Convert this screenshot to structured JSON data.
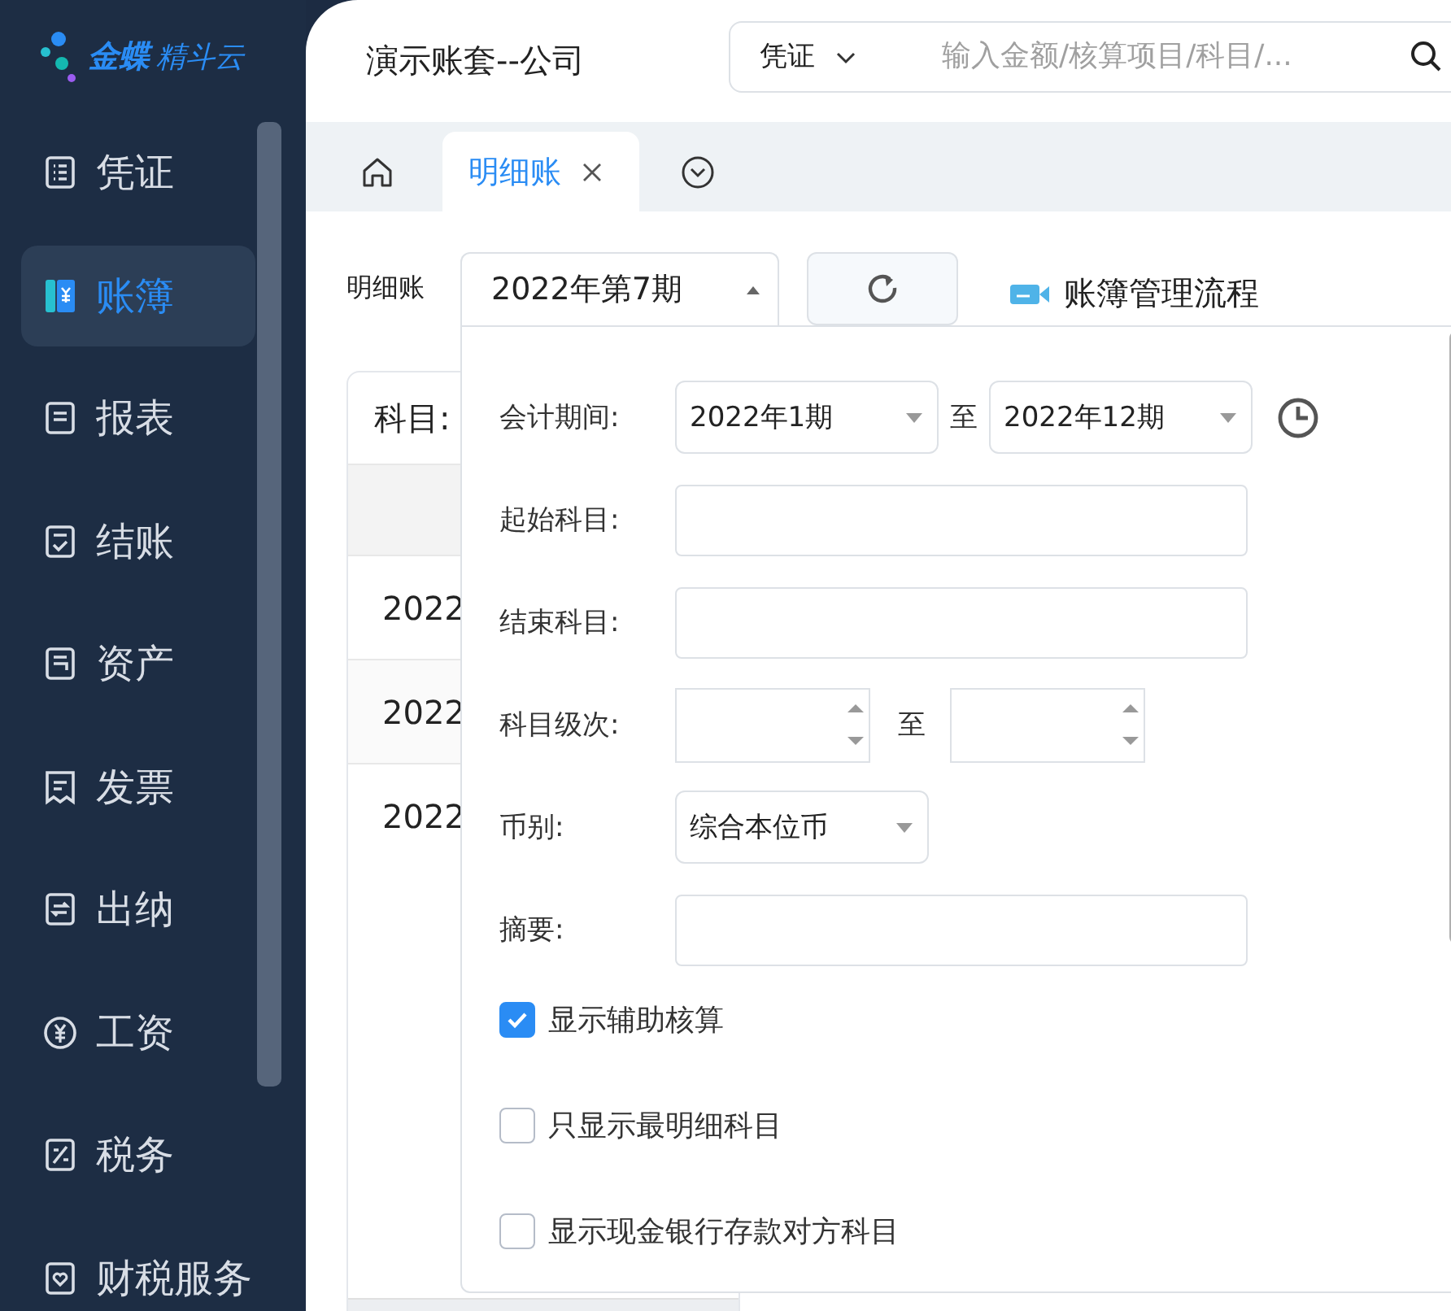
{
  "sidebar": {
    "logo": {
      "brand": "金蝶",
      "product": "精斗云"
    },
    "items": [
      {
        "label": "凭证",
        "selected": false
      },
      {
        "label": "账簿",
        "selected": true
      },
      {
        "label": "报表",
        "selected": false
      },
      {
        "label": "结账",
        "selected": false
      },
      {
        "label": "资产",
        "selected": false
      },
      {
        "label": "发票",
        "selected": false
      },
      {
        "label": "出纳",
        "selected": false
      },
      {
        "label": "工资",
        "selected": false
      },
      {
        "label": "税务",
        "selected": false
      },
      {
        "label": "财税服务",
        "selected": false
      }
    ]
  },
  "header": {
    "account_set": "演示账套--公司",
    "search": {
      "scope": "凭证",
      "placeholder": "输入金额/核算项目/科目/..."
    }
  },
  "tabs": [
    {
      "label": "明细账",
      "selected": true
    }
  ],
  "toolbar": {
    "label": "明细账",
    "period": "2022年第7期",
    "flow_link": "账簿管理流程"
  },
  "table": {
    "subject_label": "科目:",
    "rows": [
      {
        "column_1": "2022"
      },
      {
        "column_1": "2022"
      },
      {
        "column_1": "2022"
      }
    ]
  },
  "filter_panel": {
    "fields": [
      {
        "kind": "period_range",
        "label": "会计期间:",
        "from": "2022年1期",
        "to_label": "至",
        "to": "2022年12期"
      },
      {
        "kind": "text",
        "label": "起始科目:"
      },
      {
        "kind": "text",
        "label": "结束科目:"
      },
      {
        "kind": "number_range",
        "label": "科目级次:",
        "to_label": "至"
      },
      {
        "kind": "select",
        "label": "币别:",
        "value": "综合本位币"
      },
      {
        "kind": "text",
        "label": "摘要:"
      }
    ],
    "options": [
      {
        "label": "显示辅助核算",
        "checked": true
      },
      {
        "label": "只显示最明细科目",
        "checked": false
      },
      {
        "label": "显示现金银行存款对方科目",
        "checked": false
      }
    ]
  }
}
